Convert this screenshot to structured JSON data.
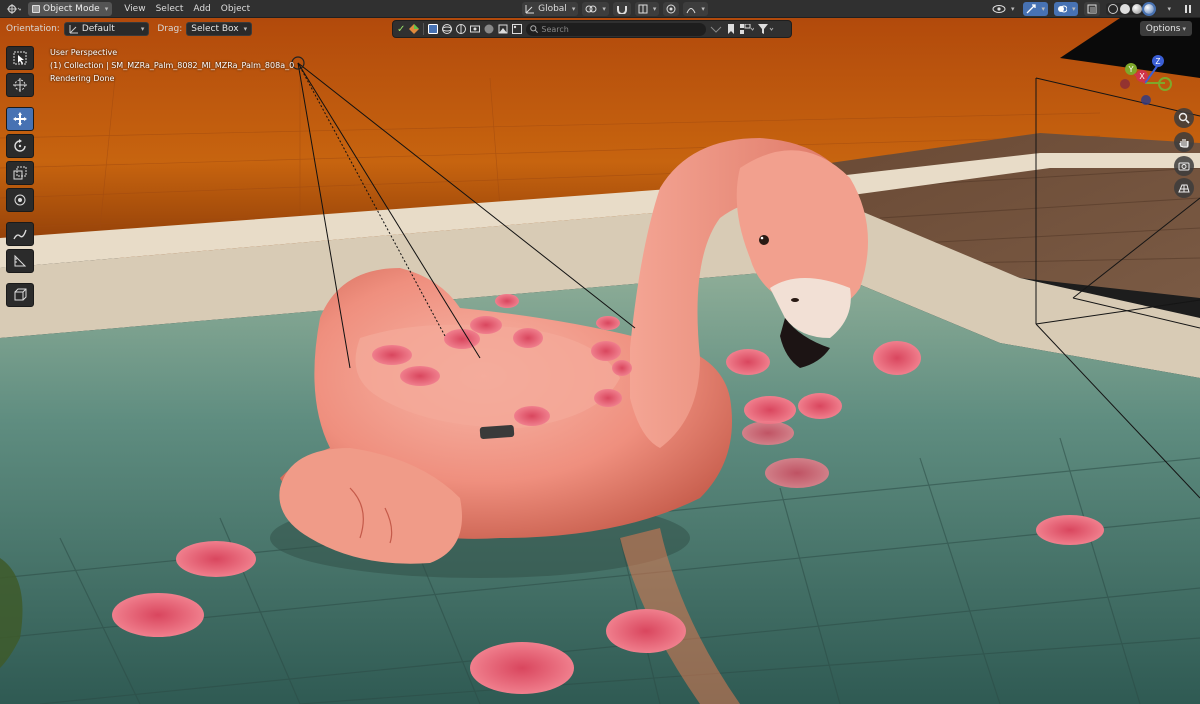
{
  "header": {
    "editor_type_icon": "editor-type-icon",
    "mode": "Object Mode",
    "menus": [
      "View",
      "Select",
      "Add",
      "Object"
    ],
    "transform_orientation": "Global"
  },
  "toolrow": {
    "orientation_label": "Orientation:",
    "orientation_value": "Default",
    "drag_label": "Drag:",
    "drag_value": "Select Box",
    "search_placeholder": "Search",
    "options_label": "Options"
  },
  "viewport": {
    "perspective": "User Perspective",
    "object_info": "(1) Collection | SM_MZRa_Palm_8082_MI_MZRa_Palm_808a_0",
    "status": "Rendering Done"
  },
  "gizmo": {
    "x_label": "X",
    "y_label": "Y",
    "z_label": "Z"
  },
  "tools": [
    "select-box",
    "cursor",
    "move",
    "rotate",
    "scale",
    "transform",
    "annotate",
    "measure",
    "add-cube"
  ],
  "colors": {
    "active_blue": "#4772b3",
    "header_bg": "#303030",
    "sky_orange": "#c85a12",
    "water": "#5a8a7e",
    "flamingo": "#f0907f"
  }
}
